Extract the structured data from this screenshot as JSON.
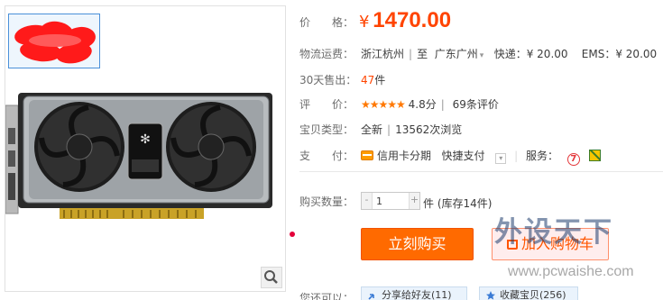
{
  "price": {
    "label": "价　　格：",
    "currency": "¥",
    "amount": "1470.00"
  },
  "shipping": {
    "label": "物流运费：",
    "from": "浙江杭州",
    "sep": "|",
    "to_word": "至",
    "to": "广东广州",
    "express": "快递：¥ 20.00",
    "ems": "EMS：¥ 20.00"
  },
  "sales": {
    "label": "30天售出：",
    "count": "47",
    "unit": "件"
  },
  "rating": {
    "label": "评　　价：",
    "stars": "★★★★★",
    "score": "4.8分",
    "sep": "|",
    "count_num": "69",
    "count_unit": "条评价"
  },
  "type": {
    "label": "宝贝类型：",
    "condition": "全新",
    "sep": "|",
    "views": "13562次浏览"
  },
  "payment": {
    "label": "支　　付：",
    "credit": "信用卡分期",
    "quick": "快捷支付",
    "service_label": "服务：",
    "service_icon_text": "7"
  },
  "quantity": {
    "label": "购买数量：",
    "value": "1",
    "minus": "-",
    "plus": "+",
    "unit": "件",
    "stock": "(库存14件)"
  },
  "buttons": {
    "buy": "立刻购买",
    "cart": "加入购物车"
  },
  "share": {
    "label": "您还可以：",
    "share_btn": "分享给好友(11)",
    "fav_btn": "收藏宝贝(256)"
  },
  "watermark": {
    "title": "外设天下",
    "url": "www.pcwaishe.com"
  },
  "colors": {
    "price": "#ff4400",
    "buy_button": "#ff6a00",
    "cart_border": "#ff8f6b",
    "stars": "#ff7800"
  },
  "icons": [
    "zoom-icon",
    "credit-card-icon",
    "dropdown-arrow-icon",
    "seven-day-return-icon",
    "guarantee-icon",
    "cart-icon",
    "share-icon",
    "favorite-icon"
  ]
}
